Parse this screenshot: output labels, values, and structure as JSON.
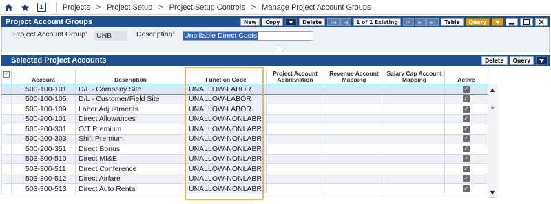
{
  "breadcrumbs": [
    "Projects",
    "Project Setup",
    "Project Setup Controls",
    "Manage Project Account Groups"
  ],
  "topbar": {
    "box_icon_text": "1"
  },
  "panel": {
    "title": "Project Account Groups",
    "buttons": {
      "new": "New",
      "copy": "Copy",
      "delete": "Delete",
      "table": "Table",
      "query": "Query"
    },
    "counter": "1 of 1 Existing"
  },
  "form": {
    "group_label": "Project Account Group",
    "group_value": "UNB",
    "description_label": "Description",
    "description_value": "Unbillable Direct Costs"
  },
  "subpanel": {
    "title": "Selected Project Accounts",
    "buttons": {
      "delete": "Delete",
      "query": "Query"
    }
  },
  "table": {
    "columns": [
      "Account",
      "Description",
      "Function Code",
      "Project Account Abbreviation",
      "Revenue Account Mapping",
      "Salary Cap Account Mapping",
      "Active"
    ],
    "rows": [
      {
        "account": "500-100-101",
        "description": "D/L - Company Site",
        "function_code": "UNALLOW-LABOR",
        "abbreviation": "",
        "revenue": "",
        "salary_cap": "",
        "active": true
      },
      {
        "account": "500-100-105",
        "description": "D/L - Customer/Field Site",
        "function_code": "UNALLOW-LABOR",
        "abbreviation": "",
        "revenue": "",
        "salary_cap": "",
        "active": true
      },
      {
        "account": "500-100-109",
        "description": "Labor Adjustments",
        "function_code": "UNALLOW-LABOR",
        "abbreviation": "",
        "revenue": "",
        "salary_cap": "",
        "active": true
      },
      {
        "account": "500-200-101",
        "description": "Direct Allowances",
        "function_code": "UNALLOW-NONLABR",
        "abbreviation": "",
        "revenue": "",
        "salary_cap": "",
        "active": true
      },
      {
        "account": "500-200-301",
        "description": "O/T Premium",
        "function_code": "UNALLOW-NONLABR",
        "abbreviation": "",
        "revenue": "",
        "salary_cap": "",
        "active": true
      },
      {
        "account": "500-200-303",
        "description": "Shift Premium",
        "function_code": "UNALLOW-NONLABR",
        "abbreviation": "",
        "revenue": "",
        "salary_cap": "",
        "active": true
      },
      {
        "account": "500-200-351",
        "description": "Direct Bonus",
        "function_code": "UNALLOW-NONLABR",
        "abbreviation": "",
        "revenue": "",
        "salary_cap": "",
        "active": true
      },
      {
        "account": "503-300-510",
        "description": "Direct MI&E",
        "function_code": "UNALLOW-NONLABR",
        "abbreviation": "",
        "revenue": "",
        "salary_cap": "",
        "active": true
      },
      {
        "account": "503-300-511",
        "description": "Direct Conference",
        "function_code": "UNALLOW-NONLABR",
        "abbreviation": "",
        "revenue": "",
        "salary_cap": "",
        "active": true
      },
      {
        "account": "503-300-512",
        "description": "Direct Airfare",
        "function_code": "UNALLOW-NONLABR",
        "abbreviation": "",
        "revenue": "",
        "salary_cap": "",
        "active": true
      },
      {
        "account": "503-300-513",
        "description": "Direct Auto Rental",
        "function_code": "UNALLOW-NONLABR",
        "abbreviation": "",
        "revenue": "",
        "salary_cap": "",
        "active": true
      }
    ]
  },
  "colors": {
    "header_blue": "#1f4f8f",
    "query_gold": "#d9a31a",
    "highlight": "#e7b64b",
    "selected_outline": "#2aa7c9"
  },
  "icons": [
    "home-icon",
    "star-icon",
    "window-count-icon",
    "first-record-icon",
    "previous-record-icon",
    "next-record-icon",
    "last-record-icon",
    "refresh-icon",
    "query-dropdown-icon",
    "minimize-icon",
    "maximize-icon",
    "close-icon"
  ]
}
